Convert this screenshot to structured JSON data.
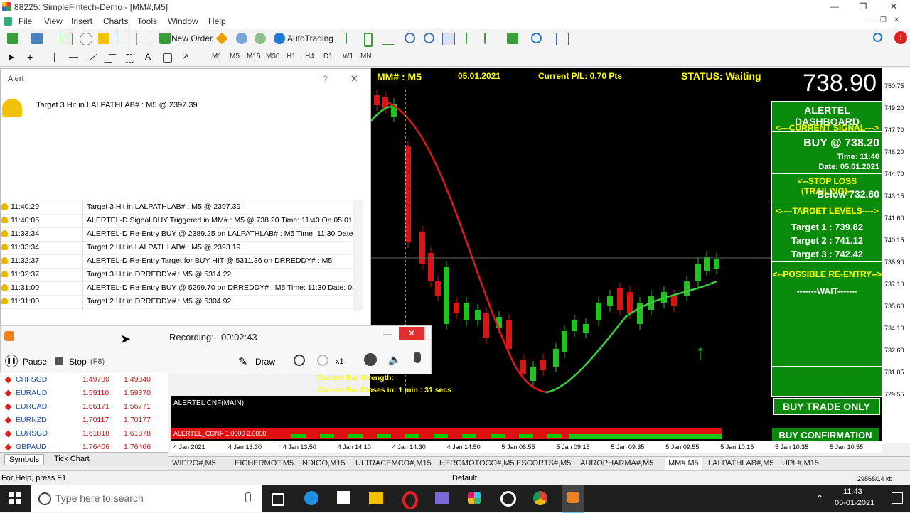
{
  "window": {
    "title": "88225: SimpleFintech-Demo - [MM#,M5]"
  },
  "menu": [
    "File",
    "View",
    "Insert",
    "Charts",
    "Tools",
    "Window",
    "Help"
  ],
  "toolbar": {
    "new_order": "New Order",
    "autotrading": "AutoTrading"
  },
  "timeframes": [
    "M1",
    "M5",
    "M15",
    "M30",
    "H1",
    "H4",
    "D1",
    "W1",
    "MN"
  ],
  "alert": {
    "title": "Alert",
    "help": "?",
    "close": "✕",
    "message": "Target 3 Hit in LALPATHLAB# : M5 @ 2397.39",
    "rows": [
      {
        "time": "11:40:29",
        "msg": "Target 3 Hit in LALPATHLAB# : M5 @ 2397.39"
      },
      {
        "time": "11:40:05",
        "msg": "ALERTEL-D Signal BUY Triggered in MM# : M5 @ 738.20 Time: 11:40 On 05.01..."
      },
      {
        "time": "11:33:34",
        "msg": "ALERTEL-D Re-Entry BUY @ 2389.25 on LALPATHLAB# : M5 Time: 11:30 Date: ..."
      },
      {
        "time": "11:33:34",
        "msg": "Target 2 Hit in LALPATHLAB# : M5 @ 2393.19"
      },
      {
        "time": "11:32:37",
        "msg": "ALERTEL-D Re-Entry Target for BUY HIT @ 5311.36 on DRREDDY# : M5"
      },
      {
        "time": "11:32:37",
        "msg": "Target 3 Hit in DRREDDY# : M5 @ 5314.22"
      },
      {
        "time": "11:31:00",
        "msg": "ALERTEL-D Re-Entry BUY @ 5299.70 on DRREDDY# : M5 Time: 11:30 Date: 05..."
      },
      {
        "time": "11:31:00",
        "msg": "Target 2 Hit in DRREDDY# : M5 @ 5304.92"
      }
    ]
  },
  "recorder": {
    "label": "Recording:",
    "elapsed": "00:02:43",
    "pause": "Pause",
    "stop": "Stop",
    "stop_key": "(F8)",
    "draw": "Draw",
    "zoom": "x1"
  },
  "market_watch": {
    "rows": [
      {
        "symbol": "CHFSGD",
        "bid": "1.49780",
        "ask": "1.49840"
      },
      {
        "symbol": "EURAUD",
        "bid": "1.59110",
        "ask": "1.59370"
      },
      {
        "symbol": "EURCAD",
        "bid": "1.56171",
        "ask": "1.56771"
      },
      {
        "symbol": "EURNZD",
        "bid": "1.70117",
        "ask": "1.70177"
      },
      {
        "symbol": "EURSGD",
        "bid": "1.61818",
        "ask": "1.61878"
      },
      {
        "symbol": "GBPAUD",
        "bid": "1.76406",
        "ask": "1.76466"
      }
    ],
    "tabs": [
      "Symbols",
      "Tick Chart"
    ]
  },
  "chart": {
    "symbol": "MM# : M5",
    "date": "05.01.2021",
    "pl": "Current P/L: 0.70 Pts",
    "status": "STATUS: Waiting",
    "price": "738.90",
    "bar_strength": "Current Bar Strength:",
    "bar_closes": "Current Bar Closes in: 1 min : 31 secs",
    "indicator_label": "ALERTEL CNF(MAIN)",
    "indicator_values": "ALERTEL_CONF 1.0000 2.0000",
    "buy_only": "BUY TRADE ONLY",
    "buy_confirm": "BUY CONFIRMATION",
    "price_ticks": [
      "750.75",
      "749.20",
      "747.70",
      "746.20",
      "744.70",
      "743.15",
      "741.60",
      "740.15",
      "738.90",
      "737.10",
      "735.60",
      "734.10",
      "732.60",
      "731.05",
      "729.55"
    ],
    "price_label_current": "738.90",
    "time_ticks": [
      "4 Jan 2021",
      "4 Jan 13:30",
      "4 Jan 13:50",
      "4 Jan 14:10",
      "4 Jan 14:30",
      "4 Jan 14:50",
      "5 Jan 08:55",
      "5 Jan 09:15",
      "5 Jan 09:35",
      "5 Jan 09:55",
      "5 Jan 10:15",
      "5 Jan 10:35",
      "5 Jan 10:55"
    ]
  },
  "dashboard": {
    "title": "ALERTEL DASHBOARD",
    "current_signal": "<---CURRENT SIGNAL--->",
    "signal": "BUY @ 738.20",
    "time": "Time: 11:40",
    "date": "Date: 05.01.2021",
    "stop_loss_hdr": "<--STOP LOSS (TRAILING)--",
    "stop_loss": "Below 732.60",
    "targets_hdr": "<----TARGET LEVELS---->",
    "targets": [
      "Target 1  : 739.82",
      "Target 2  : 741.12",
      "Target 3  : 742.42"
    ],
    "reentry_hdr": "<--POSSIBLE RE-ENTRY-->",
    "reentry": "-------WAIT-------"
  },
  "chart_tabs": [
    "WIPRO#,M5",
    "EICHERMOT,M5",
    "INDIGO,M15",
    "ULTRACEMCO#,M15",
    "HEROMOTOCO#,M5",
    "ESCORTS#,M5",
    "AUROPHARMA#,M5",
    "MM#,M5",
    "LALPATHLAB#,M5",
    "UPL#,M15"
  ],
  "status_bar": {
    "help": "For Help, press F1",
    "profile": "Default",
    "traffic": "29868/14 kb"
  },
  "taskbar": {
    "search_placeholder": "Type here to search",
    "time": "11:43",
    "date": "05-01-2021"
  },
  "colors": {
    "dashboard": "#0a8a0a",
    "bull": "#22c022",
    "bear": "#d81414",
    "label_yellow": "#ffff00"
  }
}
